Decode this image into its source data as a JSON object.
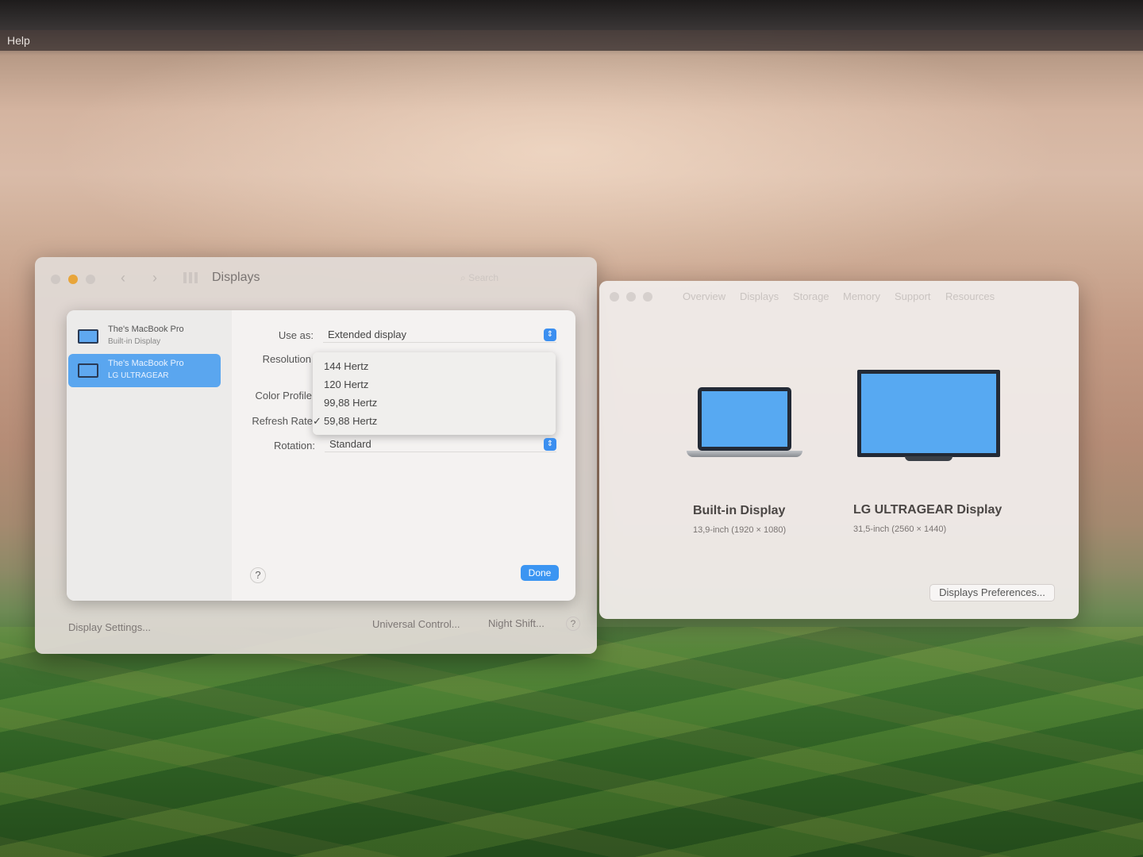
{
  "menubar": {
    "help": "Help"
  },
  "settings": {
    "title": "Displays",
    "search_placeholder": "Search",
    "displays": [
      {
        "name": "The's MacBook Pro",
        "sub": "Built-in Display"
      },
      {
        "name": "The's MacBook Pro",
        "sub": "LG ULTRAGEAR"
      }
    ],
    "labels": {
      "use_as": "Use as:",
      "resolution": "Resolution",
      "color_profile": "Color Profile",
      "refresh_rate": "Refresh Rate",
      "rotation": "Rotation:"
    },
    "use_as_value": "Extended display",
    "rotation_value": "Standard",
    "refresh_options": [
      "144 Hertz",
      "120 Hertz",
      "99,88 Hertz",
      "59,88 Hertz"
    ],
    "refresh_selected": "59,88 Hertz",
    "check_mark": "✓",
    "help": "?",
    "done": "Done",
    "footer": {
      "display_settings": "Display Settings...",
      "universal_control": "Universal Control...",
      "night_shift": "Night Shift...",
      "help": "?"
    }
  },
  "about": {
    "tabs": [
      "Overview",
      "Displays",
      "Storage",
      "Memory",
      "Support",
      "Resources"
    ],
    "builtin": {
      "title": "Built-in Display",
      "spec": "13,9-inch (1920 × 1080)"
    },
    "lg": {
      "title": "LG ULTRAGEAR Display",
      "spec": "31,5-inch (2560 × 1440)"
    },
    "prefs_button": "Displays Preferences..."
  },
  "colors": {
    "accent": "#3b8ff0",
    "selection": "#5aa6ef",
    "screen": "#57a9f2"
  }
}
